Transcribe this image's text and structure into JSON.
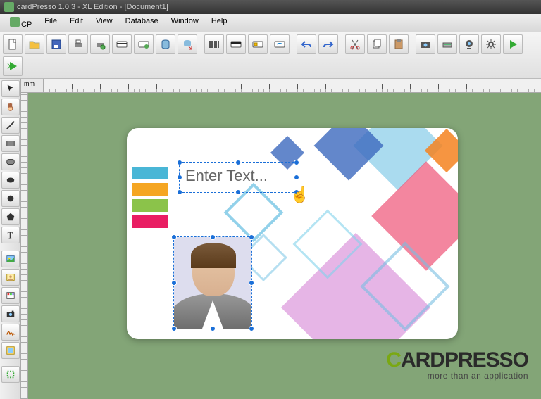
{
  "title": "cardPresso 1.0.3 - XL Edition - [Document1]",
  "menus": [
    "CP",
    "File",
    "Edit",
    "View",
    "Database",
    "Window",
    "Help"
  ],
  "toolbar_icons": [
    "new-doc",
    "open",
    "save",
    "print",
    "print-config",
    "encode-card",
    "encode-settings",
    "database",
    "db-link",
    "sep",
    "barcode",
    "mag-stripe",
    "smart-chip",
    "rfid",
    "sep",
    "undo",
    "redo",
    "sep",
    "cut",
    "copy",
    "paste",
    "sep",
    "camera",
    "scanner",
    "webcam",
    "settings",
    "run",
    "run-fast"
  ],
  "left_tools": [
    "select",
    "hand",
    "line",
    "rectangle",
    "rounded-rect",
    "ellipse",
    "circle",
    "polygon",
    "text",
    "sep",
    "image",
    "photo",
    "color-image",
    "camera-tool",
    "signature",
    "background",
    "sep",
    "clip"
  ],
  "ruler_unit": "mm",
  "card": {
    "text_placeholder": "Enter Text...",
    "color_blocks": [
      "#49b6d6",
      "#f5a623",
      "#8bc34a",
      "#e91e63"
    ]
  },
  "branding": {
    "name_prefix": "C",
    "name_prefix2": "ARD",
    "name_suffix": "PRESSO",
    "tagline": "more than an application"
  }
}
